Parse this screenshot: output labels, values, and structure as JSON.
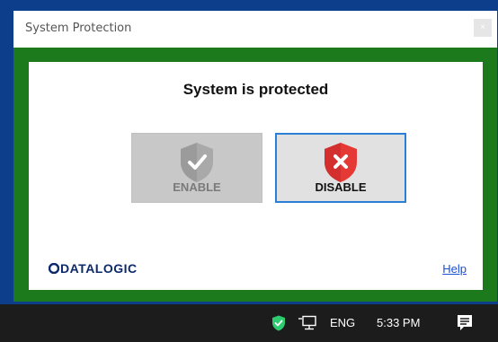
{
  "window": {
    "title": "System Protection",
    "close_label": "×"
  },
  "panel": {
    "status_heading": "System is protected",
    "enable_button": {
      "label": "ENABLE",
      "icon": "shield-check-icon",
      "state": "inactive"
    },
    "disable_button": {
      "label": "DISABLE",
      "icon": "shield-x-icon",
      "state": "focused"
    },
    "brand": "DATALOGIC",
    "help_link": "Help"
  },
  "taskbar": {
    "tray_icons": [
      "security-shield-icon",
      "network-icon",
      "notifications-icon"
    ],
    "language": "ENG",
    "clock": "5:33 PM"
  },
  "colors": {
    "desktop": "#0d3e8c",
    "window_frame": "#1c7a1c",
    "disable_shield": "#e53935",
    "focus_border": "#2b7fd6",
    "brand_text": "#0c2a6b",
    "link": "#1a4fd6",
    "taskbar": "#1c1c1c",
    "tray_shield": "#2ecc71"
  }
}
